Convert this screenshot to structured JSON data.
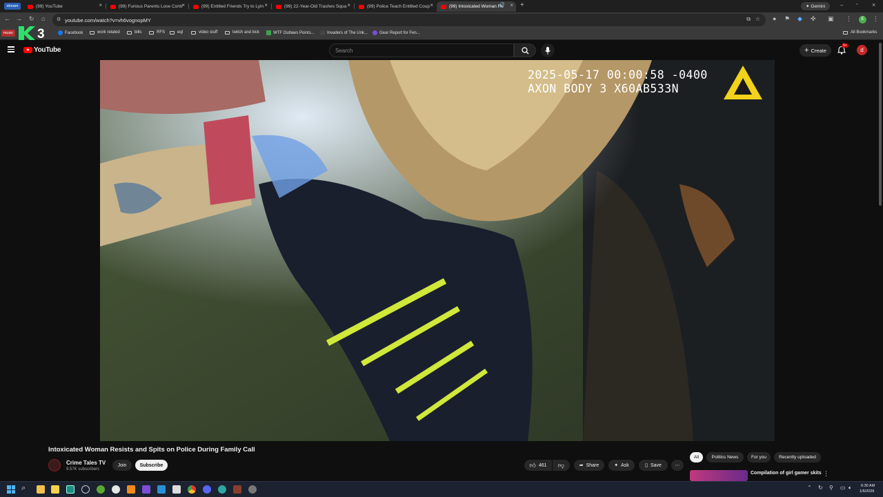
{
  "browser": {
    "tabs": [
      {
        "label": "stream",
        "tag": true
      },
      {
        "label": "(99) YouTube"
      },
      {
        "label": "(99) Furious Parents Lose Contr"
      },
      {
        "label": "(99) Entitled Friends Try to Lyin"
      },
      {
        "label": "(99) 22-Year-Old Trashes Squa"
      },
      {
        "label": "(99) Police Teach Entitled Coup"
      },
      {
        "label": "(99) Intoxicated Woman Re"
      }
    ],
    "new_tab_label": "+",
    "gemini_label": "Gemini",
    "address": "youtube.com/watch?v=vh6vognopMY",
    "profile_letter": "E",
    "bookmarks": [
      {
        "label": "music"
      },
      {
        "label": "Facebook"
      },
      {
        "label": "work related"
      },
      {
        "label": "bills"
      },
      {
        "label": "RFS"
      },
      {
        "label": "eql"
      },
      {
        "label": "video stuff"
      },
      {
        "label": "twitch and kick"
      },
      {
        "label": "WTF Outlaws Points..."
      },
      {
        "label": "Invaders of The Unk..."
      },
      {
        "label": "Gear Report for Fen..."
      }
    ],
    "all_bookmarks_label": "All Bookmarks"
  },
  "youtube": {
    "logo_text": "YouTube",
    "search_placeholder": "Search",
    "create_label": "Create",
    "notif_badge": "9+",
    "avatar_letter": "d"
  },
  "video": {
    "overlay_line1": "2025-05-17 00:00:58 -0400",
    "overlay_line2": "AXON BODY 3 X60AB533N",
    "title": "Intoxicated Woman Resists and Spits on Police During Family Call",
    "watermark": "K3"
  },
  "channel": {
    "name": "Crime Tales TV",
    "subscribers": "9.57K subscribers",
    "join_label": "Join",
    "subscribe_label": "Subscribe"
  },
  "actions": {
    "likes": "461",
    "share_label": "Share",
    "ask_label": "Ask",
    "save_label": "Save"
  },
  "chips": [
    "All",
    "Politics News",
    "For you",
    "Recently uploaded"
  ],
  "recommendation": {
    "title": "Compilation of girl gamer skits"
  },
  "taskbar": {
    "time": "6:30 AM",
    "date": "1/6/2026"
  },
  "colors": {
    "youtube_red": "#ff0000",
    "bg": "#0f0f0f",
    "taskbar": "#1c2230"
  }
}
